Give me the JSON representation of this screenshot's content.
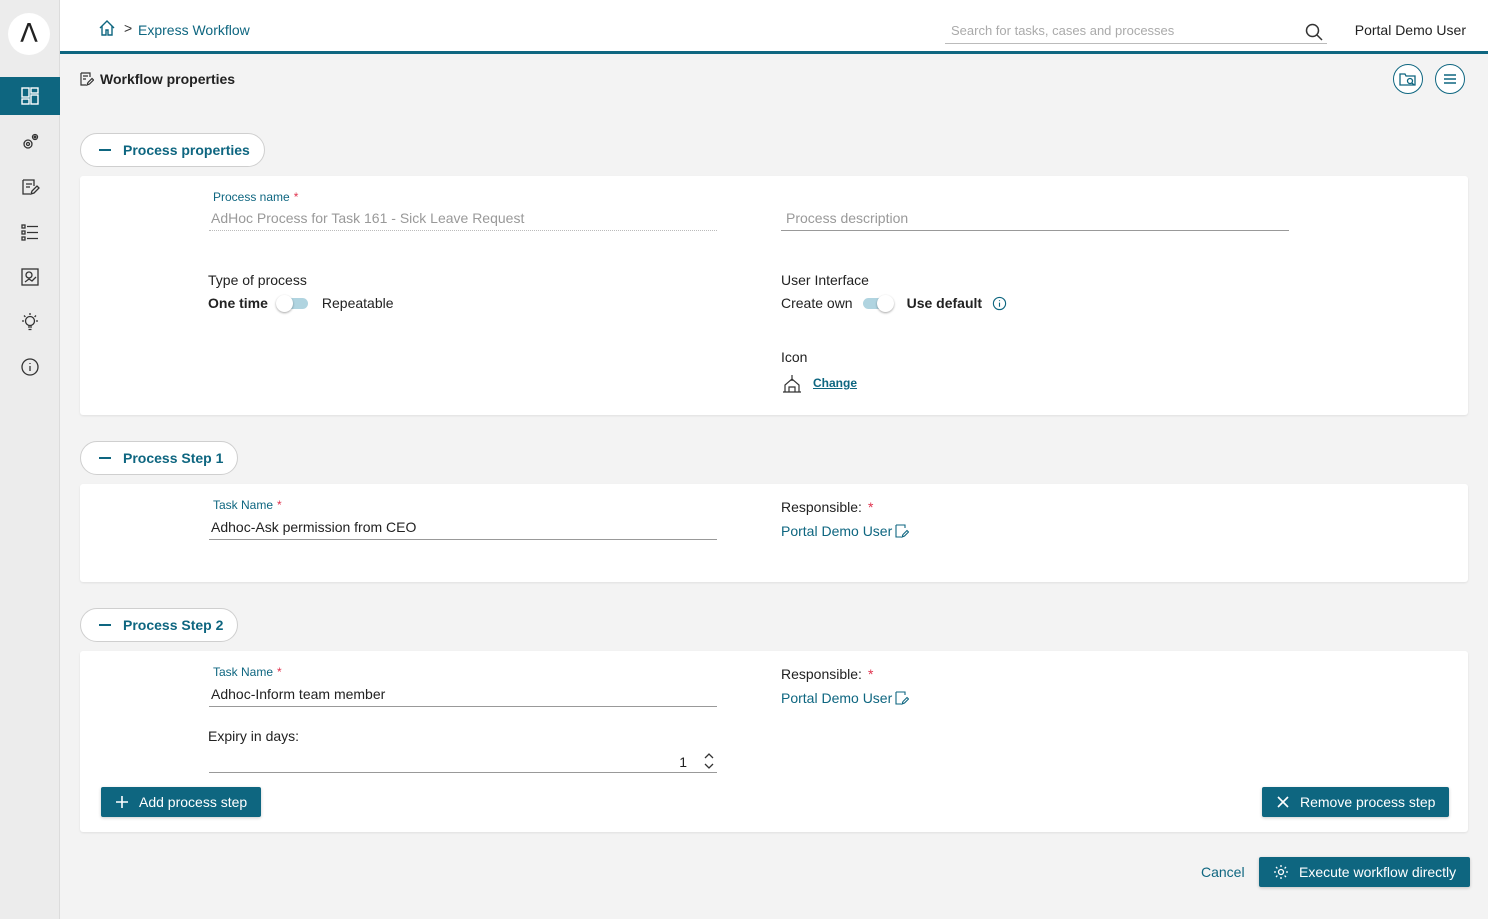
{
  "sidebar": {
    "logo": "Λ",
    "items": [
      {
        "name": "dashboard",
        "icon": "dashboard-icon",
        "active": true
      },
      {
        "name": "processes",
        "icon": "gears-icon"
      },
      {
        "name": "tasks",
        "icon": "task-edit-icon"
      },
      {
        "name": "cases",
        "icon": "list-icon"
      },
      {
        "name": "statistics",
        "icon": "chart-icon"
      },
      {
        "name": "ideas",
        "icon": "lightbulb-icon"
      },
      {
        "name": "about",
        "icon": "info-icon"
      }
    ]
  },
  "header": {
    "breadcrumb": "Express Workflow",
    "search_placeholder": "Search for tasks, cases and processes",
    "user": "Portal Demo User"
  },
  "page": {
    "title": "Workflow properties"
  },
  "process_properties": {
    "toggle_label": "Process properties",
    "name_label": "Process name",
    "name_value": "AdHoc Process for Task 161 - Sick Leave Request",
    "description_placeholder": "Process description",
    "type_label": "Type of process",
    "type_option_one": "One time",
    "type_option_two": "Repeatable",
    "ui_label": "User Interface",
    "ui_option_one": "Create own",
    "ui_option_two": "Use default",
    "icon_label": "Icon",
    "icon_change": "Change"
  },
  "step1": {
    "toggle_label": "Process Step 1",
    "task_label": "Task Name",
    "task_value": "Adhoc-Ask permission from CEO",
    "responsible_label": "Responsible:",
    "responsible_value": "Portal Demo User"
  },
  "step2": {
    "toggle_label": "Process Step 2",
    "task_label": "Task Name",
    "task_value": "Adhoc-Inform team member",
    "responsible_label": "Responsible:",
    "responsible_value": "Portal Demo User",
    "expiry_label": "Expiry in days:",
    "expiry_value": "1",
    "add_button": "Add process step",
    "remove_button": "Remove process step"
  },
  "footer": {
    "cancel": "Cancel",
    "execute": "Execute workflow directly"
  },
  "colors": {
    "accent": "#0e6680",
    "required": "#e0334e"
  }
}
